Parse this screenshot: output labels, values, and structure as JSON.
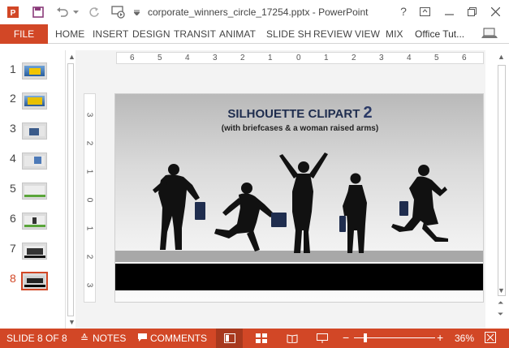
{
  "window": {
    "title": "corporate_winners_circle_17254.pptx - PowerPoint",
    "help": "?",
    "icons": [
      "powerpoint-icon",
      "save-icon",
      "undo-icon",
      "redo-icon",
      "start-from-beginning-icon",
      "customize-qat-icon",
      "ribbon-display-icon",
      "minimize-icon",
      "restore-icon",
      "close-icon"
    ]
  },
  "ribbon": {
    "file": "FILE",
    "tabs": [
      "HOME",
      "INSERT",
      "DESIGN",
      "TRANSIT",
      "ANIMAT",
      "SLIDE SH",
      "REVIEW",
      "VIEW",
      "MIX"
    ],
    "account": "Office Tut..."
  },
  "slides": {
    "numbers": [
      "1",
      "2",
      "3",
      "4",
      "5",
      "6",
      "7",
      "8"
    ],
    "selected_index": 8
  },
  "ruler": {
    "horizontal": [
      "6",
      "5",
      "4",
      "3",
      "2",
      "1",
      "0",
      "1",
      "2",
      "3",
      "4",
      "5",
      "6"
    ],
    "vertical": [
      "3",
      "2",
      "1",
      "0",
      "1",
      "2",
      "3"
    ]
  },
  "slide": {
    "title": "SILHOUETTE CLIPART",
    "title_number": "2",
    "subtitle": "(with briefcases & a woman raised arms)"
  },
  "status": {
    "slide_indicator": "SLIDE 8 OF 8",
    "notes": "NOTES",
    "comments": "COMMENTS",
    "zoom": "36%",
    "zoom_level": 0.36,
    "zoom_minus": "−",
    "zoom_plus": "+"
  },
  "colors": {
    "accent": "#d24726",
    "slide_title": "#1f2d4e"
  }
}
